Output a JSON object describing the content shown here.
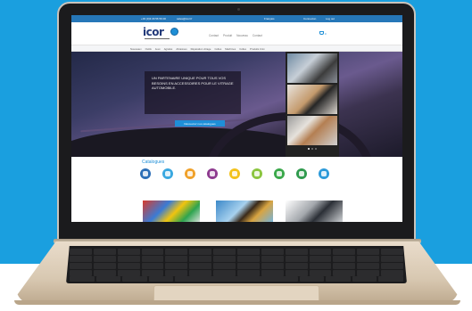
{
  "topbar": {
    "phone": "+33 (0)3 29 56 56 00",
    "email": "sales@icor.fr",
    "language": "Français",
    "account": "Connexion",
    "login": "Log out"
  },
  "header": {
    "logo": "icor",
    "nav": [
      "Contact",
      "Produit",
      "Nouveau",
      "Contact"
    ],
    "cart_count": "0"
  },
  "catbar": {
    "items": [
      "Nouveaux",
      "Outils",
      "Jeux",
      "Agrafes",
      "Abrasives",
      "Réparation vitrage",
      "Colles",
      "Machines",
      "Colles",
      "Produits Univ"
    ]
  },
  "hero": {
    "text": "UN PARTENAIRE UNIQUE POUR TOUS VOS BESOINS EN ACCESSOIRES POUR LE VITRAGE AUTOMOBILE.",
    "button": "Découvrez nos catalogues"
  },
  "catalogues": {
    "title": "Catalogues",
    "icons": [
      {
        "name": "catalog-icon-1",
        "color": "#2c6fb7"
      },
      {
        "name": "catalog-icon-2",
        "color": "#3aa8e0"
      },
      {
        "name": "catalog-icon-3",
        "color": "#f0a12a"
      },
      {
        "name": "catalog-icon-4",
        "color": "#8e3b8f"
      },
      {
        "name": "catalog-icon-5",
        "color": "#f3c21b"
      },
      {
        "name": "catalog-icon-6",
        "color": "#8bc53f"
      },
      {
        "name": "catalog-icon-7",
        "color": "#3aa84a"
      },
      {
        "name": "catalog-icon-8",
        "color": "#2f9a4d"
      },
      {
        "name": "catalog-icon-9",
        "color": "#2c9ad9"
      }
    ]
  }
}
